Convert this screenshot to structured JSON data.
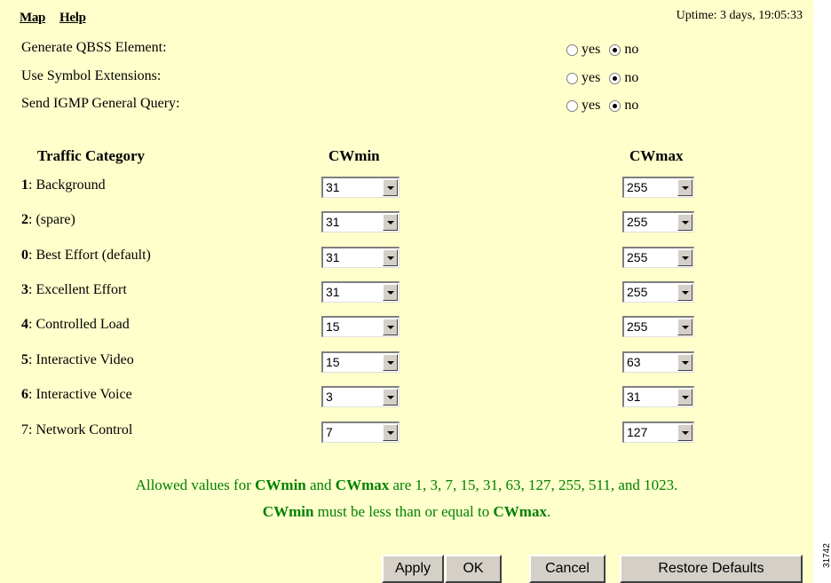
{
  "nav": {
    "map": "Map",
    "help": "Help"
  },
  "uptime": "Uptime: 3 days, 19:05:33",
  "options": [
    {
      "label": "Generate QBSS Element:",
      "yes": "yes",
      "no": "no",
      "selected": "no"
    },
    {
      "label": "Use Symbol Extensions:",
      "yes": "yes",
      "no": "no",
      "selected": "no"
    },
    {
      "label": "Send IGMP General Query:",
      "yes": "yes",
      "no": "no",
      "selected": "no"
    }
  ],
  "table": {
    "headers": {
      "category": "Traffic Category",
      "cwmin": "CWmin",
      "cwmax": "CWmax"
    },
    "rows": [
      {
        "num": "1",
        "name": ": Background",
        "cwmin": "31",
        "cwmax": "255"
      },
      {
        "num": "2",
        "name": ": (spare)",
        "cwmin": "31",
        "cwmax": "255"
      },
      {
        "num": "0",
        "name": ": Best Effort (default)",
        "cwmin": "31",
        "cwmax": "255"
      },
      {
        "num": "3",
        "name": ": Excellent Effort",
        "cwmin": "31",
        "cwmax": "255"
      },
      {
        "num": "4",
        "name": ": Controlled Load",
        "cwmin": "15",
        "cwmax": "255"
      },
      {
        "num": "5",
        "name": ": Interactive Video",
        "cwmin": "15",
        "cwmax": "63"
      },
      {
        "num": "6",
        "name": ": Interactive Voice",
        "cwmin": "3",
        "cwmax": "31"
      },
      {
        "num": "7",
        "name": ": Network Control",
        "cwmin": "7",
        "cwmax": "127"
      }
    ]
  },
  "note": {
    "line1_pre": "Allowed values for ",
    "line1_b1": "CWmin",
    "line1_mid": " and ",
    "line1_b2": "CWmax",
    "line1_post": " are 1, 3, 7, 15, 31, 63, 127, 255, 511, and 1023.",
    "line2_b1": "CWmin",
    "line2_mid": " must be less than or equal to ",
    "line2_b2": "CWmax",
    "line2_post": ".",
    "color": "#008000"
  },
  "buttons": {
    "apply": "Apply",
    "ok": "OK",
    "cancel": "Cancel",
    "restore": "Restore Defaults"
  },
  "figure_id": "31742",
  "colors": {
    "background": "#ffffcc",
    "button": "#d4d0c8"
  }
}
